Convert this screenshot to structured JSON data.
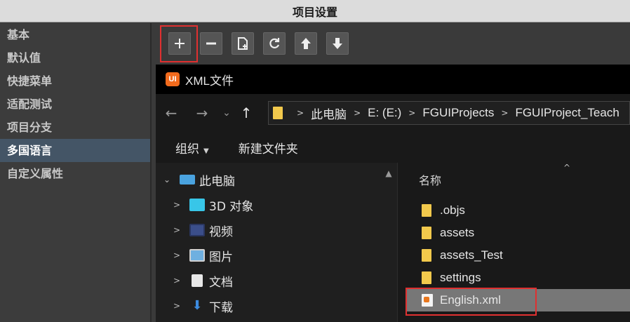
{
  "window": {
    "title": "项目设置"
  },
  "sidebar": {
    "items": [
      {
        "label": "基本",
        "active": false
      },
      {
        "label": "默认值",
        "active": false
      },
      {
        "label": "快捷菜单",
        "active": false
      },
      {
        "label": "适配测试",
        "active": false
      },
      {
        "label": "项目分支",
        "active": false
      },
      {
        "label": "多国语言",
        "active": true
      },
      {
        "label": "自定义属性",
        "active": false
      }
    ]
  },
  "toolbar": {
    "buttons": [
      {
        "name": "add",
        "icon": "plus-icon"
      },
      {
        "name": "remove",
        "icon": "minus-icon"
      },
      {
        "name": "new-file",
        "icon": "new-file-icon"
      },
      {
        "name": "refresh",
        "icon": "refresh-icon"
      },
      {
        "name": "move-up",
        "icon": "arrow-up-icon"
      },
      {
        "name": "move-down",
        "icon": "arrow-down-icon"
      }
    ]
  },
  "dialog": {
    "logo_text": "UI",
    "title": "XML文件",
    "nav": {
      "back": "←",
      "forward": "→",
      "recent": "⌄",
      "up": "↑"
    },
    "breadcrumb": [
      "此电脑",
      "E: (E:)",
      "FGUIProjects",
      "FGUIProject_Teach"
    ],
    "commands": {
      "organize": "组织",
      "new_folder": "新建文件夹"
    },
    "tree": [
      {
        "label": "此电脑",
        "expanded": true,
        "icon": "computer-icon",
        "indent": 0
      },
      {
        "label": "3D 对象",
        "icon": "3d-objects-icon",
        "indent": 1
      },
      {
        "label": "视频",
        "icon": "video-icon",
        "indent": 1
      },
      {
        "label": "图片",
        "icon": "pictures-icon",
        "indent": 1
      },
      {
        "label": "文档",
        "icon": "documents-icon",
        "indent": 1
      },
      {
        "label": "下载",
        "icon": "downloads-icon",
        "indent": 1
      }
    ],
    "file_list": {
      "column_name": "名称",
      "files": [
        {
          "name": ".objs",
          "type": "folder"
        },
        {
          "name": "assets",
          "type": "folder"
        },
        {
          "name": "assets_Test",
          "type": "folder"
        },
        {
          "name": "settings",
          "type": "folder"
        },
        {
          "name": "English.xml",
          "type": "xml",
          "selected": true
        }
      ]
    }
  },
  "colors": {
    "highlight": "#e03030",
    "folder": "#f2c94c",
    "logo": "#f26b1d",
    "active_sidebar": "#445566"
  }
}
